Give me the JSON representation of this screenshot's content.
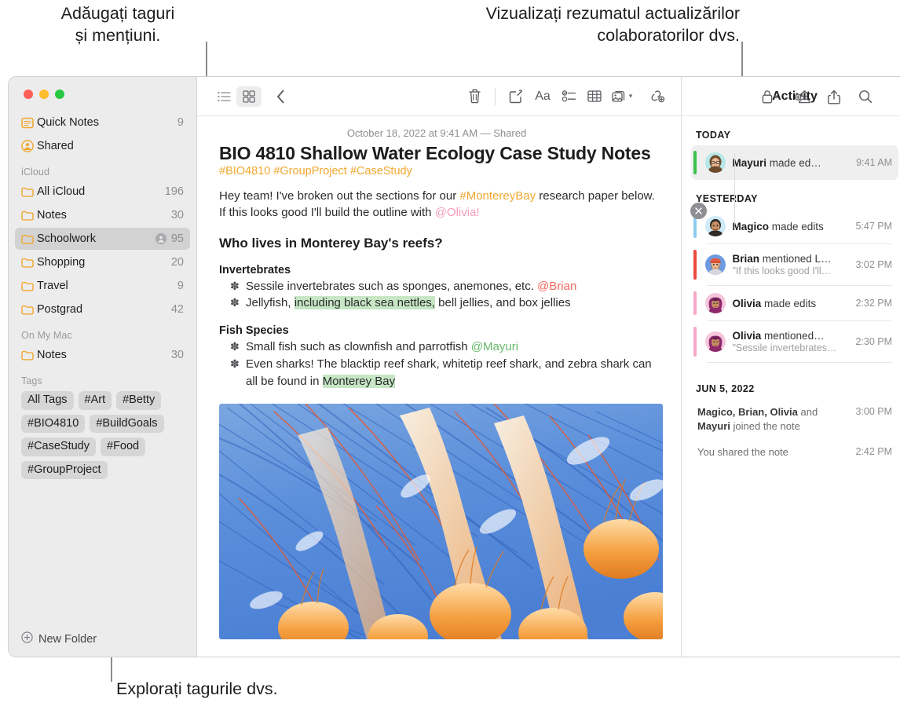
{
  "callouts": {
    "top_left": "Adăugați taguri\nși mențiuni.",
    "top_right": "Vizualizați rezumatul actualizărilor\ncolaboratorilor dvs.",
    "bottom_left": "Explorați tagurile dvs."
  },
  "sidebar": {
    "top_items": [
      {
        "label": "Quick Notes",
        "count": "9",
        "icon": "quick-note-icon",
        "shared": false
      },
      {
        "label": "Shared",
        "count": "",
        "icon": "shared-person-icon",
        "shared": false
      }
    ],
    "sections": [
      {
        "header": "iCloud",
        "items": [
          {
            "label": "All iCloud",
            "count": "196",
            "icon": "folder-icon",
            "shared": false,
            "selected": false
          },
          {
            "label": "Notes",
            "count": "30",
            "icon": "folder-icon",
            "shared": false,
            "selected": false
          },
          {
            "label": "Schoolwork",
            "count": "95",
            "icon": "folder-icon",
            "shared": true,
            "selected": true
          },
          {
            "label": "Shopping",
            "count": "20",
            "icon": "folder-icon",
            "shared": false,
            "selected": false
          },
          {
            "label": "Travel",
            "count": "9",
            "icon": "folder-icon",
            "shared": false,
            "selected": false
          },
          {
            "label": "Postgrad",
            "count": "42",
            "icon": "folder-icon",
            "shared": false,
            "selected": false
          }
        ]
      },
      {
        "header": "On My Mac",
        "items": [
          {
            "label": "Notes",
            "count": "30",
            "icon": "folder-icon",
            "shared": false,
            "selected": false
          }
        ]
      }
    ],
    "tags_header": "Tags",
    "tags": [
      "All Tags",
      "#Art",
      "#Betty",
      "#BIO4810",
      "#BuildGoals",
      "#CaseStudy",
      "#Food",
      "#GroupProject"
    ],
    "new_folder_label": "New Folder"
  },
  "toolbar": {
    "items": [
      {
        "name": "list-view-icon",
        "label": "List View"
      },
      {
        "name": "gallery-view-icon",
        "label": "Gallery View"
      },
      {
        "name": "back-chevron-icon",
        "label": "Back"
      },
      {
        "name": "trash-icon",
        "label": "Delete"
      },
      {
        "name": "compose-icon",
        "label": "New Note"
      },
      {
        "name": "format-text-icon",
        "label": "Aa"
      },
      {
        "name": "checklist-icon",
        "label": "Checklist"
      },
      {
        "name": "table-icon",
        "label": "Table"
      },
      {
        "name": "media-icon",
        "label": "Media"
      },
      {
        "name": "link-add-icon",
        "label": "Add Link"
      },
      {
        "name": "lock-icon",
        "label": "Lock"
      },
      {
        "name": "add-person-icon",
        "label": "Share Note"
      },
      {
        "name": "share-icon",
        "label": "Share"
      },
      {
        "name": "search-icon",
        "label": "Search"
      }
    ],
    "format_label": "Aa"
  },
  "note": {
    "date": "October 18, 2022 at 9:41 AM — Shared",
    "title": "BIO 4810 Shallow Water Ecology Case Study Notes",
    "tags": "#BIO4810 #GroupProject #CaseStudy",
    "intro": {
      "part1": "Hey team! I've broken out the sections for our ",
      "hashtag": "#MontereyBay",
      "part2": " research paper below. If this looks good I'll build the outline with ",
      "mention": "@Olivia!"
    },
    "heading": "Who lives in Monterey Bay's reefs?",
    "sections": [
      {
        "subheading": "Invertebrates",
        "bullets": [
          {
            "pre": "Sessile invertebrates such as sponges, anemones, etc. ",
            "mention": "@Brian",
            "mention_color": "red",
            "post": "",
            "highlight": "",
            "tail": ""
          },
          {
            "pre": "Jellyfish, ",
            "mention": "",
            "mention_color": "",
            "highlight": "including black sea nettles,",
            "tail": " bell jellies, and box jellies"
          }
        ]
      },
      {
        "subheading": "Fish Species",
        "bullets": [
          {
            "pre": "Small fish such as clownfish and parrotfish ",
            "mention": "@Mayuri",
            "mention_color": "green",
            "highlight": "",
            "tail": ""
          },
          {
            "pre": "Even sharks! The blacktip reef shark, whitetip reef shark, and zebra shark can all be found in ",
            "mention": "",
            "mention_color": "",
            "highlight": "Monterey Bay",
            "tail": ""
          }
        ]
      }
    ],
    "image_alt": "jellyfish-photo"
  },
  "activity": {
    "title": "Activity",
    "close_label": "×",
    "groups": [
      {
        "label": "TODAY",
        "items": [
          {
            "name_bold": "Mayuri",
            "rest": " made ed…",
            "quote": "",
            "time": "9:41 AM",
            "bar_color": "#39c24a",
            "avatar_bg": "#b7e6e6",
            "avatar_hair": "#7a5336",
            "avatar_skin": "#e9bb91",
            "selected": true
          }
        ]
      },
      {
        "label": "YESTERDAY",
        "items": [
          {
            "name_bold": "Magico",
            "rest": " made edits",
            "quote": "",
            "time": "5:47 PM",
            "bar_color": "#8ecbec",
            "avatar_bg": "#cfe9f7",
            "avatar_hair": "#2d2a28",
            "avatar_skin": "#c98f63",
            "selected": false
          },
          {
            "name_bold": "Brian",
            "rest": " mentioned L…",
            "quote": "\"If this looks good I'll…",
            "time": "3:02 PM",
            "bar_color": "#ea4b3c",
            "avatar_bg": "#6e9ae0",
            "avatar_hair": "#e8593f",
            "avatar_skin": "#e9bb91",
            "selected": false
          },
          {
            "name_bold": "Olivia",
            "rest": " made edits",
            "quote": "",
            "time": "2:32 PM",
            "bar_color": "#f7a8c8",
            "avatar_bg": "#f6c6dc",
            "avatar_hair": "#8e2a6b",
            "avatar_skin": "#c98f63",
            "selected": false
          },
          {
            "name_bold": "Olivia",
            "rest": " mentioned…",
            "quote": "\"Sessile invertebrates…",
            "time": "2:30 PM",
            "bar_color": "#f7a8c8",
            "avatar_bg": "#f6c6dc",
            "avatar_hair": "#8e2a6b",
            "avatar_skin": "#c98f63",
            "selected": false
          }
        ]
      }
    ],
    "history_label": "JUN 5, 2022",
    "history": [
      {
        "bold1": "Magico, Brian, Olivia",
        "mid": " and ",
        "bold2": "Mayuri",
        "tail": " joined the note",
        "time": "3:00 PM"
      },
      {
        "bold1": "",
        "mid": "You shared the note",
        "bold2": "",
        "tail": "",
        "time": "2:42 PM"
      }
    ]
  },
  "colors": {
    "accent_yellow": "#f0a830",
    "highlight_green": "#c6e6c4",
    "selection_gray": "#d2d2d3"
  }
}
